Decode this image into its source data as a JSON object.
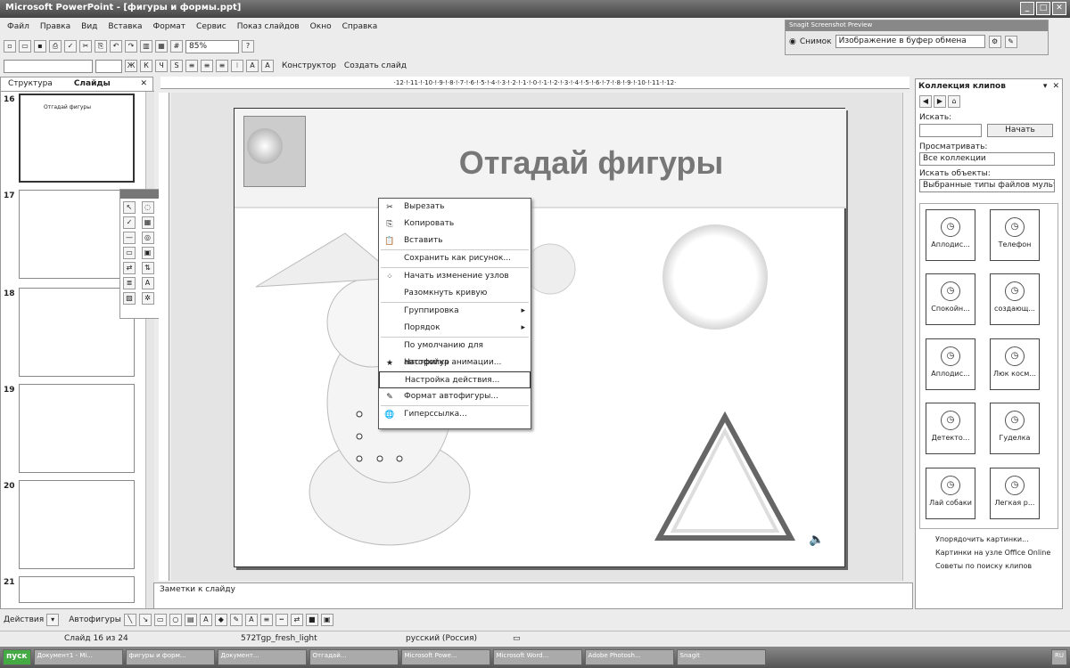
{
  "app": {
    "title": "Microsoft PowerPoint - [фигуры и формы.ppt]"
  },
  "menu": [
    "Файл",
    "Правка",
    "Вид",
    "Вставка",
    "Формат",
    "Сервис",
    "Показ слайдов",
    "Окно",
    "Справка"
  ],
  "toolbar": {
    "zoom": "85%",
    "designer": "Конструктор",
    "new_slide": "Создать слайд"
  },
  "snagit": {
    "title": "Snagit Screenshot Preview",
    "snap_label": "Снимок",
    "output": "Изображение в буфер обмена"
  },
  "left_panel": {
    "tab_structure": "Структура",
    "tab_slides": "Слайды",
    "close": "✕",
    "slides": [
      {
        "num": "16",
        "thumb_title": "Отгадай фигуры"
      },
      {
        "num": "17"
      },
      {
        "num": "18"
      },
      {
        "num": "19"
      },
      {
        "num": "20"
      },
      {
        "num": "21"
      }
    ]
  },
  "ruler": "·12·!·11·!·10·!·9·!·8·!·7·!·6·!·5·!·4·!·3·!·2·!·1·!·0·!·1·!·2·!·3·!·4·!·5·!·6·!·7·!·8·!·9·!·10·!·11·!·12·",
  "slide": {
    "title": "Отгадай фигуры"
  },
  "context_menu": [
    {
      "label": "Вырезать",
      "icon": "✂"
    },
    {
      "label": "Копировать",
      "icon": "⎘"
    },
    {
      "label": "Вставить",
      "icon": "📋"
    },
    {
      "sep": true
    },
    {
      "label": "Сохранить как рисунок...",
      "icon": ""
    },
    {
      "sep": true
    },
    {
      "label": "Начать изменение узлов",
      "icon": "⁘"
    },
    {
      "label": "Разомкнуть кривую",
      "icon": ""
    },
    {
      "sep": true
    },
    {
      "label": "Группировка",
      "icon": "",
      "sub": true
    },
    {
      "label": "Порядок",
      "icon": "",
      "sub": true
    },
    {
      "sep": true
    },
    {
      "label": "По умолчанию для автофигур",
      "icon": ""
    },
    {
      "label": "Настройка анимации...",
      "icon": "★"
    },
    {
      "label": "Настройка действия...",
      "icon": "",
      "highlight": true
    },
    {
      "label": "Формат автофигуры...",
      "icon": "✎"
    },
    {
      "sep": true
    },
    {
      "label": "Гиперссылка...",
      "icon": "🌐"
    }
  ],
  "clip_panel": {
    "title": "Коллекция клипов",
    "search_label": "Искать:",
    "search_value": "",
    "search_button": "Начать",
    "browse_label": "Просматривать:",
    "browse_value": "Все коллекции",
    "objects_label": "Искать объекты:",
    "objects_value": "Выбранные типы файлов мульти",
    "clips": [
      "Аплодис...",
      "Телефон",
      "Спокойн...",
      "создающ...",
      "Аплодис...",
      "Люк косм...",
      "Детекто...",
      "Гуделка",
      "Лай собаки",
      "Легкая р..."
    ],
    "links": [
      "Упорядочить картинки...",
      "Картинки на узле Office Online",
      "Советы по поиску клипов"
    ]
  },
  "notes": "Заметки к слайду",
  "draw_toolbar": {
    "actions": "Действия",
    "autoshapes": "Автофигуры"
  },
  "status": {
    "slide": "Слайд 16 из 24",
    "design": "572Tgp_fresh_light",
    "lang": "русский (Россия)"
  },
  "taskbar": {
    "start": "пуск",
    "items": [
      "Документ1 - Mi...",
      "фигуры и форм...",
      "Документ...",
      "Отгадай...",
      "Microsoft Powe...",
      "Microsoft Word...",
      "Adobe Photosh...",
      "Snagit"
    ],
    "clock": "RU"
  }
}
